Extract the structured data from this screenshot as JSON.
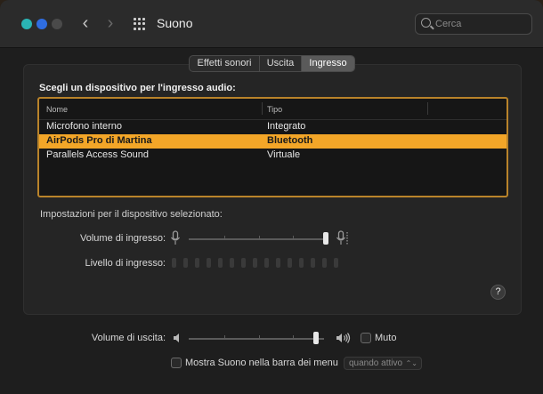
{
  "window": {
    "title": "Suono"
  },
  "search": {
    "placeholder": "Cerca"
  },
  "tabs": [
    {
      "label": "Effetti sonori",
      "selected": false
    },
    {
      "label": "Uscita",
      "selected": false
    },
    {
      "label": "Ingresso",
      "selected": true
    }
  ],
  "input": {
    "prompt": "Scegli un dispositivo per l'ingresso audio:",
    "columns": [
      "Nome",
      "Tipo"
    ],
    "devices": [
      {
        "name": "Microfono interno",
        "type": "Integrato",
        "selected": false
      },
      {
        "name": "AirPods Pro di Martina",
        "type": "Bluetooth",
        "selected": true
      },
      {
        "name": "Parallels Access Sound",
        "type": "Virtuale",
        "selected": false
      }
    ],
    "settings_title": "Impostazioni per il dispositivo selezionato:",
    "volume_label": "Volume di ingresso:",
    "volume_level": 0.95,
    "level_label": "Livello di ingresso:",
    "level_active_bars": 0,
    "level_total_bars": 15
  },
  "output": {
    "volume_label": "Volume di uscita:",
    "volume_level": 0.95,
    "mute_label": "Muto",
    "mute_checked": false,
    "show_in_menubar_label": "Mostra Suono nella barra dei menu",
    "show_in_menubar_checked": false,
    "show_when_value": "quando attivo"
  },
  "help": {
    "label": "?"
  },
  "colors": {
    "accent": "#f3a628",
    "table_border": "#b9832a"
  },
  "icons": {
    "back": "chevron-left-icon",
    "forward": "chevron-right-icon",
    "grid": "grid-icon",
    "search": "search-icon",
    "mic_low": "microphone-icon",
    "mic_high": "microphone-loud-icon",
    "speaker_low": "speaker-icon",
    "speaker_high": "speaker-loud-icon"
  }
}
